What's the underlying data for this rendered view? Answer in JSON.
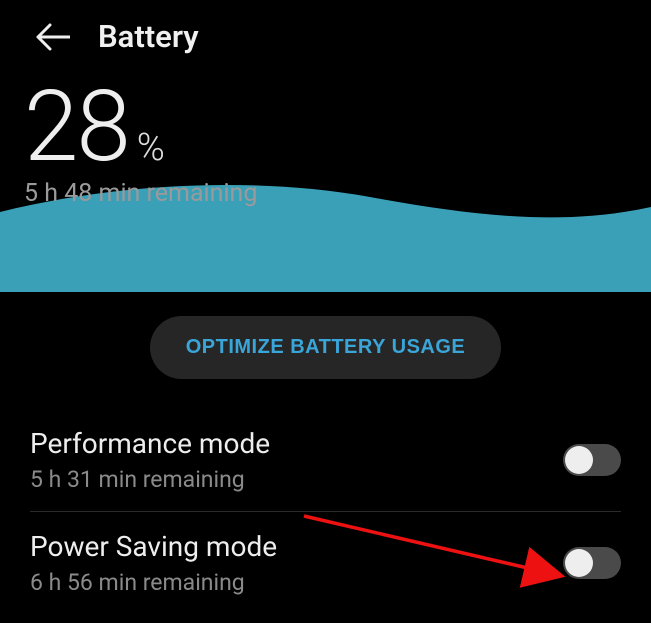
{
  "header": {
    "title": "Battery"
  },
  "battery": {
    "percent_value": "28",
    "percent_symbol": "%",
    "remaining": "5 h 48 min remaining"
  },
  "optimize": {
    "label": "OPTIMIZE BATTERY USAGE"
  },
  "modes": {
    "performance": {
      "title": "Performance mode",
      "sub": "5 h 31 min remaining",
      "enabled": false
    },
    "power_saving": {
      "title": "Power Saving mode",
      "sub": "6 h 56 min remaining",
      "enabled": false
    }
  },
  "colors": {
    "wave": "#3aa0b8",
    "accent": "#3aa5d8"
  }
}
